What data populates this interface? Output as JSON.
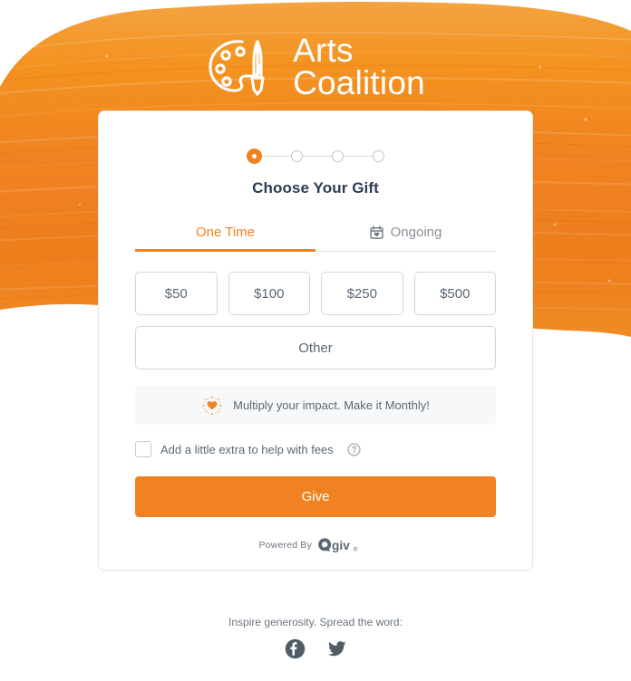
{
  "brand": {
    "name_line1": "Arts",
    "name_line2": "Coalition",
    "logo_icon": "palette-paintbrush-icon",
    "accent_color": "#F08221",
    "banner_color": "#F08221",
    "heading_color": "#2c3c52"
  },
  "card": {
    "title": "Choose Your Gift",
    "steps": {
      "total": 4,
      "current": 1
    },
    "tabs": [
      {
        "label": "One Time",
        "active": true,
        "icon": ""
      },
      {
        "label": "Ongoing",
        "active": false,
        "icon": "calendar-heart-icon"
      }
    ],
    "amounts": [
      "$50",
      "$100",
      "$250",
      "$500"
    ],
    "other_label": "Other",
    "upsell": {
      "icon": "sparkle-heart-icon",
      "text": "Multiply your impact. Make it Monthly!"
    },
    "fee": {
      "checked": false,
      "label": "Add a little extra to help with fees",
      "help_icon": "question-circle-icon"
    },
    "submit_label": "Give",
    "powered_by": {
      "text": "Powered By",
      "brand": "Qgiv",
      "trademark": "®"
    }
  },
  "footer": {
    "text": "Inspire generosity. Spread the word:",
    "socials": [
      {
        "name": "facebook-icon"
      },
      {
        "name": "twitter-icon"
      }
    ]
  }
}
